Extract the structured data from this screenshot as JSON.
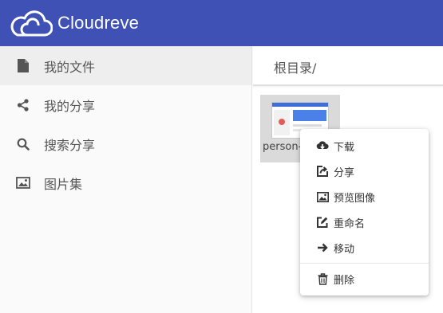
{
  "app": {
    "brand": "Cloudreve",
    "logo_icon": "cloud-logo-icon"
  },
  "colors": {
    "appbar": "#3f51b5",
    "sidebar_bg": "#fafafa",
    "active_item_bg": "#eeeeee"
  },
  "sidebar": {
    "items": [
      {
        "label": "我的文件",
        "icon": "file-icon",
        "active": true
      },
      {
        "label": "我的分享",
        "icon": "share-icon",
        "active": false
      },
      {
        "label": "搜索分享",
        "icon": "search-icon",
        "active": false
      },
      {
        "label": "图片集",
        "icon": "image-icon",
        "active": false
      }
    ]
  },
  "breadcrumb": {
    "path": "根目录/"
  },
  "files": [
    {
      "name": "person-"
    }
  ],
  "context_menu": {
    "items": [
      {
        "label": "下载",
        "icon": "cloud-download-icon"
      },
      {
        "label": "分享",
        "icon": "share-out-icon"
      },
      {
        "label": "预览图像",
        "icon": "image-icon"
      },
      {
        "label": "重命名",
        "icon": "rename-icon"
      },
      {
        "label": "移动",
        "icon": "arrow-right-icon"
      },
      {
        "label": "删除",
        "icon": "trash-icon"
      }
    ]
  }
}
